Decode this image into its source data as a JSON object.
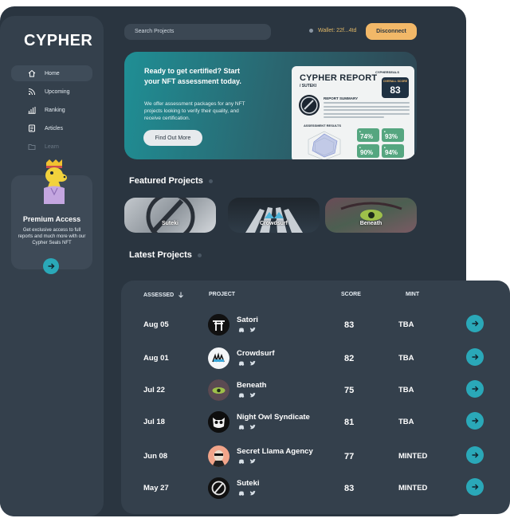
{
  "app": {
    "logo": "CYPHER"
  },
  "sidebar": {
    "items": [
      {
        "label": "Home",
        "icon": "home-icon"
      },
      {
        "label": "Upcoming",
        "icon": "rss-icon"
      },
      {
        "label": "Ranking",
        "icon": "bar-chart-icon"
      },
      {
        "label": "Articles",
        "icon": "document-icon"
      },
      {
        "label": "Learn",
        "icon": "folder-icon"
      }
    ],
    "premium": {
      "title": "Premium Access",
      "text": "Get exclusive access to full reports and much more with our Cypher Seals NFT"
    }
  },
  "header": {
    "search_placeholder": "Search Projects",
    "wallet": "Wallet: 22f...4td",
    "disconnect": "Disconnect"
  },
  "hero": {
    "title": "Ready to get certified? Start your NFT assessment today.",
    "text": "We offer assessment packages for any NFT projects looking to verify their quality, and receive certification.",
    "button": "Find Out More",
    "report": {
      "title": "CYPHER REPORT",
      "subtitle": "/ SUTEKI",
      "logo": "CYPHERSEALS",
      "overall_label": "OVERALL SCORE",
      "overall": "83",
      "summary_label": "REPORT SUMMARY",
      "results_label": "ASSESSMENT RESULTS",
      "scores": [
        "74%",
        "93%",
        "90%",
        "94%"
      ]
    }
  },
  "featured": {
    "title": "Featured Projects",
    "items": [
      "Suteki",
      "Crowdsurf",
      "Beneath"
    ]
  },
  "latest": {
    "title": "Latest Projects",
    "columns": {
      "assessed": "ASSESSED",
      "project": "PROJECT",
      "score": "SCORE",
      "mint": "MINT"
    },
    "rows": [
      {
        "date": "Aug 05",
        "project": "Satori",
        "score": "83",
        "mint": "TBA"
      },
      {
        "date": "Aug 01",
        "project": "Crowdsurf",
        "score": "82",
        "mint": "TBA"
      },
      {
        "date": "Jul 22",
        "project": "Beneath",
        "score": "75",
        "mint": "TBA"
      },
      {
        "date": "Jul 18",
        "project": "Night Owl Syndicate",
        "score": "81",
        "mint": "TBA"
      },
      {
        "date": "Jun 08",
        "project": "Secret Llama Agency",
        "score": "77",
        "mint": "MINTED"
      },
      {
        "date": "May 27",
        "project": "Suteki",
        "score": "83",
        "mint": "MINTED"
      }
    ]
  },
  "colors": {
    "accent": "#2aa8b8",
    "wallet": "#e0b766",
    "disconnect": "#f2b868",
    "panel": "#2a3540"
  }
}
